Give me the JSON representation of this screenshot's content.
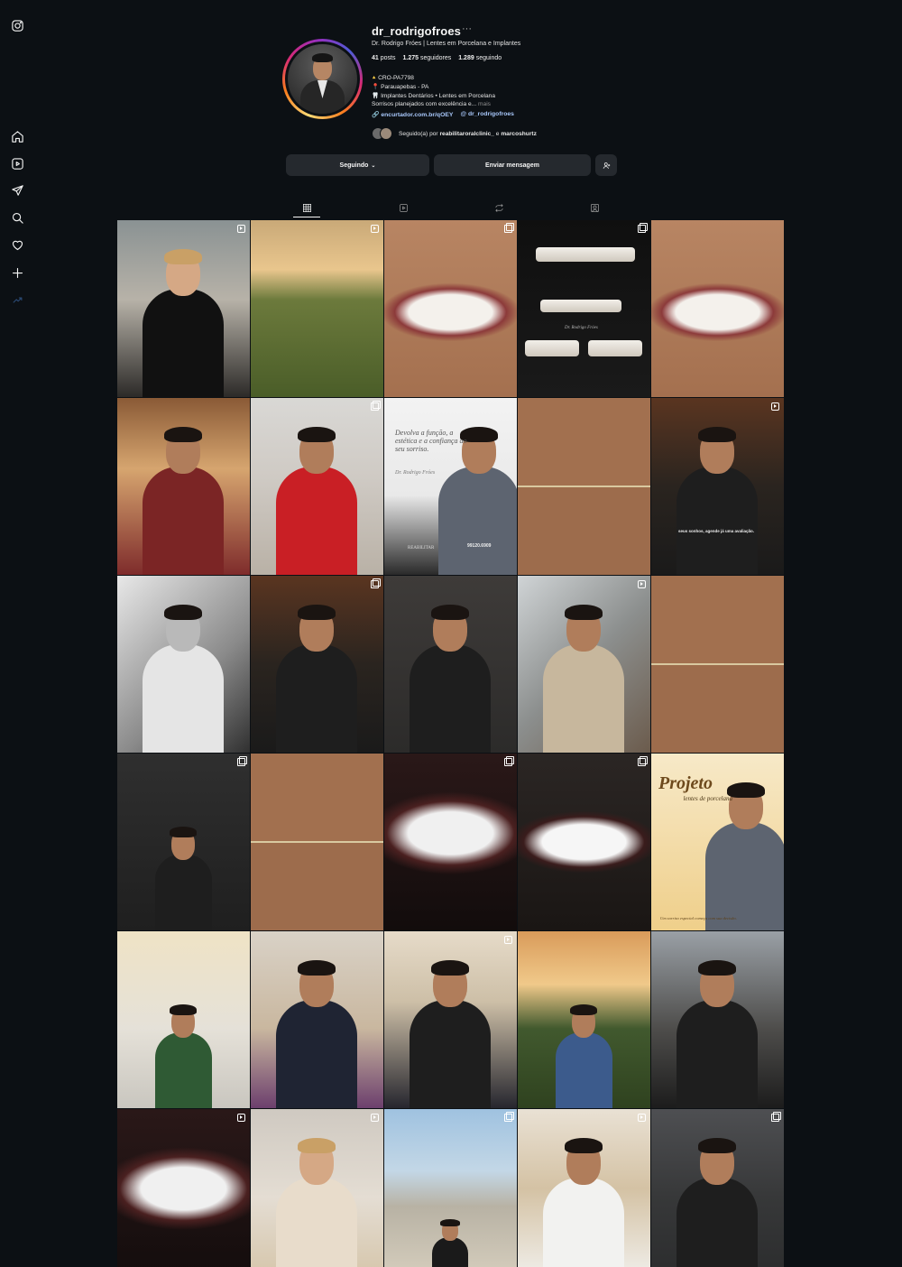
{
  "sidebar": {
    "items": [
      {
        "icon": "instagram-logo-icon"
      },
      {
        "icon": "home-icon"
      },
      {
        "icon": "reels-icon"
      },
      {
        "icon": "direct-send-icon"
      },
      {
        "icon": "search-icon"
      },
      {
        "icon": "heart-icon"
      },
      {
        "icon": "plus-icon"
      },
      {
        "icon": "threads-link-icon"
      }
    ]
  },
  "profile": {
    "username": "dr_rodrigofroes",
    "more": "···",
    "fullname": "Dr. Rodrigo Fróes | Lentes em Porcelana e Implantes",
    "stats": {
      "posts_count": "41",
      "posts_label": "posts",
      "followers_count": "1.275",
      "followers_label": "seguidores",
      "following_count": "1.289",
      "following_label": "seguindo"
    },
    "bio": {
      "line1": "CRO-PA7798",
      "line2": "Parauapebas - PA",
      "line3": "Implantes Dentários • Lentes em Porcelana",
      "line4": "Sorrisos planejados com excelência e...",
      "more": "mais"
    },
    "link": "encurtador.com.br/qOEY",
    "threads_handle": "dr_rodrigofroes",
    "followed_by_prefix": "Seguido(a) por",
    "followed_by_1": "reabilitaroralclinic_",
    "followed_by_and": "e",
    "followed_by_2": "marcoshurtz"
  },
  "actions": {
    "following_label": "Seguindo",
    "message_label": "Enviar mensagem"
  },
  "tabs": [
    {
      "icon": "grid-icon",
      "active": true
    },
    {
      "icon": "reels-tab-icon",
      "active": false
    },
    {
      "icon": "reposts-icon",
      "active": false
    },
    {
      "icon": "tagged-icon",
      "active": false
    }
  ],
  "posts": [
    {
      "kind": "portrait-woman",
      "badge": "reel"
    },
    {
      "kind": "landscape",
      "badge": "reel"
    },
    {
      "kind": "smile",
      "badge": "carousel"
    },
    {
      "kind": "veneers-dark",
      "badge": "carousel",
      "caption": "Dr. Rodrigo Fróes"
    },
    {
      "kind": "smile",
      "badge": ""
    },
    {
      "kind": "selfie",
      "badge": ""
    },
    {
      "kind": "child-red",
      "badge": "carousel"
    },
    {
      "kind": "promo-white",
      "badge": "",
      "caption": "Devolva a função, a estética e a confiança ao seu sorriso.",
      "caption2": "Dr. Rodrigo Fróes",
      "caption3": "REABILITAR",
      "caption4": "99120.6909"
    },
    {
      "kind": "smile-beforeafter",
      "badge": ""
    },
    {
      "kind": "dark-portrait",
      "badge": "reel",
      "caption": "seus sonhos, agende já uma avaliação."
    },
    {
      "kind": "bw-dentist",
      "badge": ""
    },
    {
      "kind": "dark-portrait",
      "badge": "carousel"
    },
    {
      "kind": "suit-portrait",
      "badge": ""
    },
    {
      "kind": "masked",
      "badge": "reel"
    },
    {
      "kind": "smile-beforeafter",
      "badge": ""
    },
    {
      "kind": "standing-dark",
      "badge": "carousel"
    },
    {
      "kind": "smile-beforeafter",
      "badge": ""
    },
    {
      "kind": "teeth-closeup",
      "badge": "carousel"
    },
    {
      "kind": "smile-dark",
      "badge": "carousel"
    },
    {
      "kind": "promo-gold",
      "badge": "",
      "caption": "Projeto",
      "caption2": "lentes de porcelana",
      "caption3": "Um sorriso especial começa com sua decisão."
    },
    {
      "kind": "green-selfie",
      "badge": ""
    },
    {
      "kind": "office-desk",
      "badge": ""
    },
    {
      "kind": "office-portrait",
      "badge": "reel"
    },
    {
      "kind": "field-camera",
      "badge": ""
    },
    {
      "kind": "mirror-selfie",
      "badge": ""
    },
    {
      "kind": "teeth-closeup",
      "badge": "reel"
    },
    {
      "kind": "portrait-woman2",
      "badge": "reel"
    },
    {
      "kind": "beach",
      "badge": "carousel"
    },
    {
      "kind": "white-suit",
      "badge": "reel"
    },
    {
      "kind": "kids-car",
      "badge": "carousel"
    }
  ]
}
